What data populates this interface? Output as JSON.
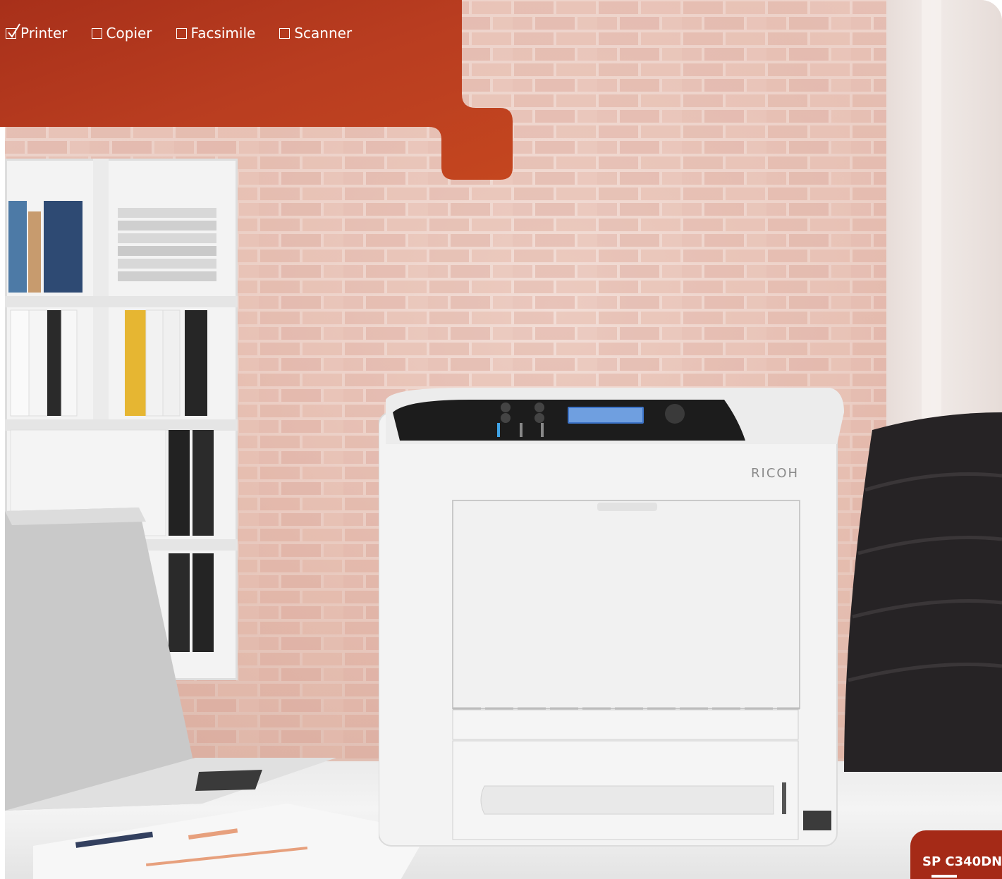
{
  "features": [
    {
      "label": "Printer",
      "checked": true
    },
    {
      "label": "Copier",
      "checked": false
    },
    {
      "label": "Facsimile",
      "checked": false
    },
    {
      "label": "Scanner",
      "checked": false
    }
  ],
  "model": "SP C340DN",
  "printer_brand": "RICOH",
  "colors": {
    "banner_red": "#b63a1f",
    "badge_red": "#a52a17",
    "text": "#ffffff"
  }
}
